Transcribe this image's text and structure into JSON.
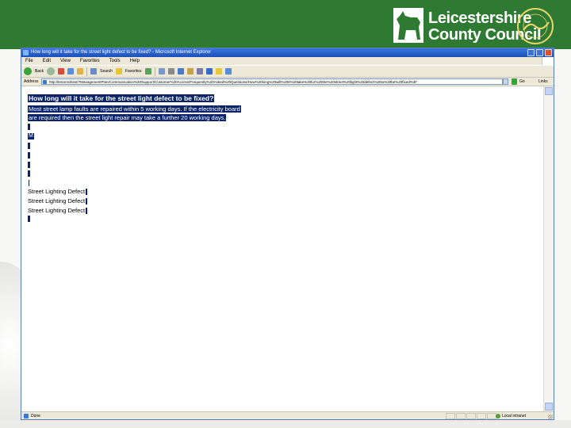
{
  "slide": {
    "logo": {
      "line1": "Leicestershire",
      "line2": "County Council",
      "seal_text": "RATED AN Excellent COUNCIL"
    },
    "colors": {
      "header_green": "#2f7a32",
      "highlight": "#0a246a"
    }
  },
  "browser": {
    "title": "How long will it take for the street light defect to be fixed? - Microsoft Internet Explorer",
    "menu": [
      "File",
      "Edit",
      "View",
      "Favorites",
      "Tools",
      "Help"
    ],
    "toolbar": {
      "back_label": "Back",
      "search_label": "Search",
      "favorites_label": "Favorites"
    },
    "address_label": "Address",
    "address_url": "http://leicsmclitest/?ManagementPlan/Communication%20Support/Customer%20Access/Frequently%20Asked%20Questions/How%20long%20will%20it%20take%20for%20the%20street%20light%20defect%20to%20be%20fixed%3F",
    "go_label": "Go",
    "links_label": "Links",
    "status_text": "Done",
    "zone_text": "Local intranet"
  },
  "page": {
    "question": "How long will it take for the street light defect to be fixed?",
    "answer_line1": "Most street lamp faults are repaired within 5 working days. If the electricity board",
    "answer_line2": "are required then the street light repair may take a further 20 working days.",
    "marker_label": "M",
    "defects": [
      "Street Lighting Defect",
      "Street Lighting Defect",
      "Street Lighting Defect"
    ]
  }
}
